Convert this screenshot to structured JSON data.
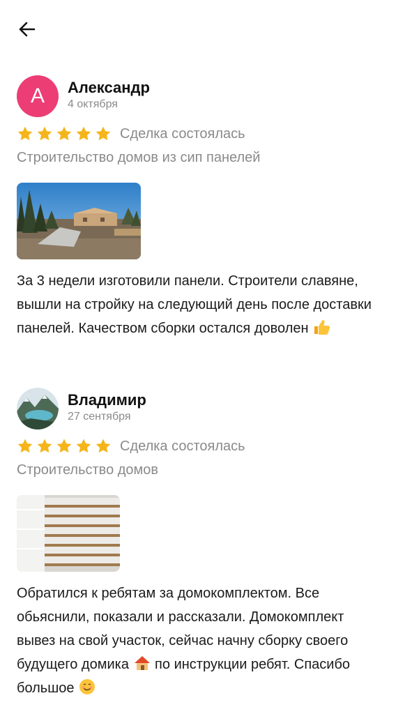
{
  "nav": {
    "back_icon": "arrow-left-icon"
  },
  "reviews": [
    {
      "author": "Александр",
      "avatar_letter": "А",
      "avatar_color": "#ec3d74",
      "date": "4 октября",
      "rating": 5,
      "deal_status": "Сделка состоялась",
      "service": "Строительство домов из сип панелей",
      "text": "За 3 недели изготовили панели. Строители славяне, вышли на стройку на следующий день после доставки панелей. Качеством сборки остался  доволен",
      "emoji": "thumbs-up-icon"
    },
    {
      "author": "Владимир",
      "date": "27 сентября",
      "rating": 5,
      "deal_status": "Сделка состоялась",
      "service": "Строительство домов",
      "text_part1": "Обратился к ребятам за домокомплектом. Все обьяснили, показали и рассказали. Домокомплект вывез на свой участок, сейчас начну сборку своего будущего домика",
      "text_part2": " по инструкции ребят. Спасибо большое",
      "emoji1": "house-icon",
      "emoji2": "smiling-face-icon"
    }
  ],
  "colors": {
    "star": "#f5b51a",
    "muted_text": "#8a8a8a"
  }
}
